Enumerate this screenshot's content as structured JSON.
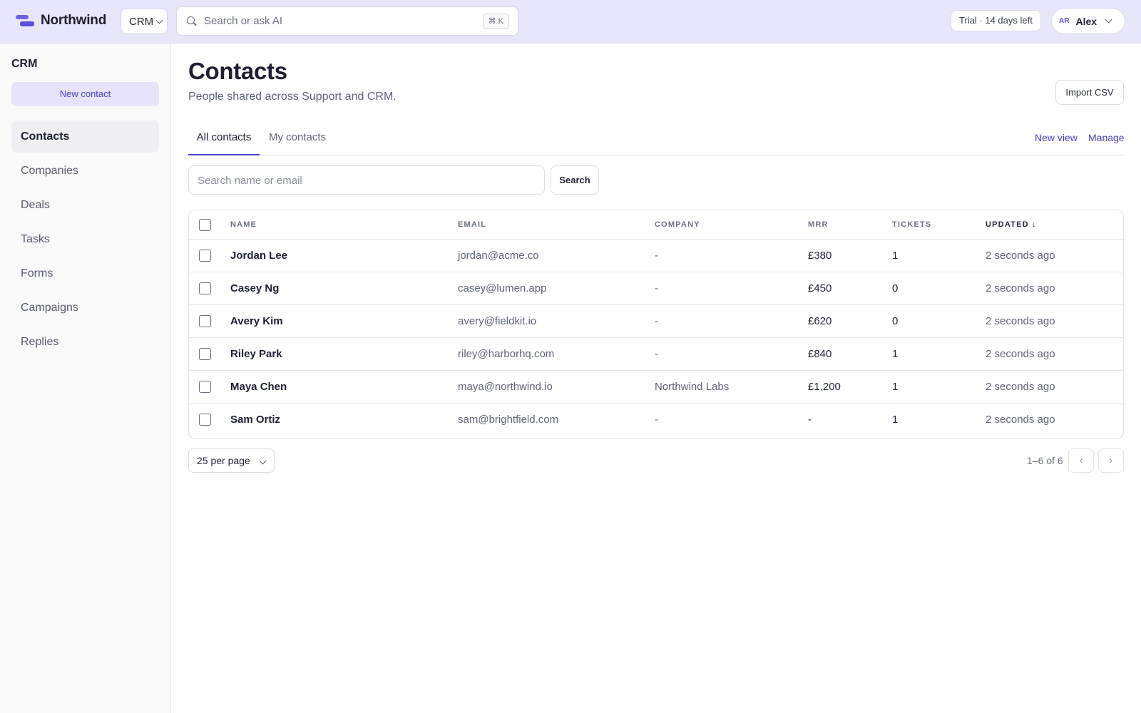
{
  "topbar": {
    "brand": "Northwind",
    "app_switch": "CRM",
    "search_placeholder": "Search or ask AI",
    "shortcut": "⌘ K",
    "trial": "Trial · 14 days left",
    "user_initials": "AR",
    "user_name": "Alex"
  },
  "sidebar": {
    "title": "CRM",
    "new_contact": "New contact",
    "items": [
      {
        "label": "Contacts",
        "active": true
      },
      {
        "label": "Companies"
      },
      {
        "label": "Deals"
      },
      {
        "label": "Tasks"
      },
      {
        "label": "Forms"
      },
      {
        "label": "Campaigns"
      },
      {
        "label": "Replies"
      }
    ]
  },
  "main": {
    "title": "Contacts",
    "subtitle": "People shared across Support and CRM.",
    "import_label": "Import CSV",
    "tabs": [
      {
        "label": "All contacts",
        "active": true
      },
      {
        "label": "My contacts"
      }
    ],
    "new_view": "New view",
    "manage": "Manage",
    "search_placeholder": "Search name or email",
    "search_button": "Search"
  },
  "table": {
    "columns": [
      "NAME",
      "EMAIL",
      "COMPANY",
      "MRR",
      "TICKETS",
      "UPDATED ↓"
    ],
    "rows": [
      {
        "name": "Jordan Lee",
        "email": "jordan@acme.co",
        "company": "-",
        "mrr": "£380",
        "tickets": "1",
        "updated": "2 seconds ago"
      },
      {
        "name": "Casey Ng",
        "email": "casey@lumen.app",
        "company": "-",
        "mrr": "£450",
        "tickets": "0",
        "updated": "2 seconds ago"
      },
      {
        "name": "Avery Kim",
        "email": "avery@fieldkit.io",
        "company": "-",
        "mrr": "£620",
        "tickets": "0",
        "updated": "2 seconds ago"
      },
      {
        "name": "Riley Park",
        "email": "riley@harborhq.com",
        "company": "-",
        "mrr": "£840",
        "tickets": "1",
        "updated": "2 seconds ago"
      },
      {
        "name": "Maya Chen",
        "email": "maya@northwind.io",
        "company": "Northwind Labs",
        "mrr": "£1,200",
        "tickets": "1",
        "updated": "2 seconds ago"
      },
      {
        "name": "Sam Ortiz",
        "email": "sam@brightfield.com",
        "company": "-",
        "mrr": "-",
        "tickets": "1",
        "updated": "2 seconds ago"
      }
    ]
  },
  "footer": {
    "per_page": "25 per page",
    "count": "1–6 of 6",
    "prev": "‹",
    "next": "›"
  }
}
